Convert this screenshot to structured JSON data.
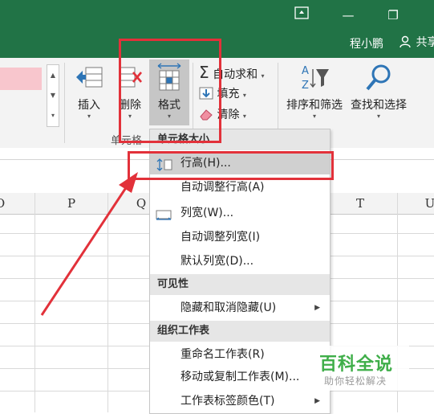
{
  "titlebar": {
    "ribbon_display_icon": "ribbon-display-icon",
    "minimize_glyph": "—",
    "restore_glyph": "❐",
    "user_name": "程小鹏",
    "share_label": "共享"
  },
  "ribbon": {
    "insert_label": "插入",
    "delete_label": "删除",
    "format_label": "格式",
    "cells_group_label": "单元格",
    "autosum_label": "自动求和",
    "fill_label": "填充",
    "clear_label": "清除",
    "sort_filter_label": "排序和筛选",
    "find_select_label": "查找和选择",
    "caret": "▾"
  },
  "columns": [
    "O",
    "P",
    "Q",
    "T",
    "U"
  ],
  "menu": {
    "header_cell_size": "单元格大小",
    "row_height": "行高(H)...",
    "autofit_row_height": "自动调整行高(A)",
    "column_width": "列宽(W)...",
    "autofit_column_width": "自动调整列宽(I)",
    "default_width": "默认列宽(D)...",
    "header_visibility": "可见性",
    "hide_unhide": "隐藏和取消隐藏(U)",
    "header_organize": "组织工作表",
    "rename_sheet": "重命名工作表(R)",
    "move_copy_sheet": "移动或复制工作表(M)...",
    "tab_color": "工作表标签颜色(T)",
    "submenu_arrow": "▶"
  },
  "watermark": {
    "title": "百科全说",
    "subtitle": "助你轻松解决"
  },
  "colors": {
    "excel_green": "#217346",
    "annotation_red": "#e2313a",
    "watermark_green": "#3fae49"
  }
}
